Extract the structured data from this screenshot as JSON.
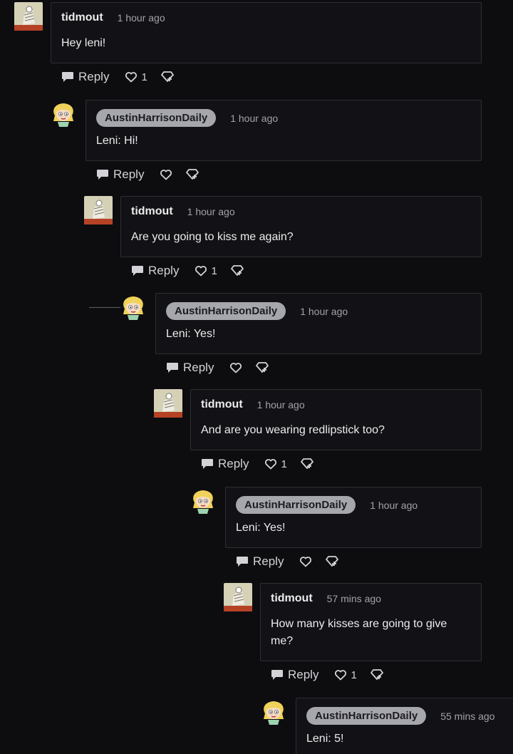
{
  "comments": [
    {
      "user": "tidmout",
      "time": "1 hour ago",
      "text": "Hey leni!",
      "reply_label": "Reply",
      "likes": "1",
      "badge": false
    },
    {
      "user": "AustinHarrisonDaily",
      "time": "1 hour ago",
      "text": "Leni: Hi!",
      "reply_label": "Reply",
      "likes": "",
      "badge": true
    },
    {
      "user": "tidmout",
      "time": "1 hour ago",
      "text": "Are you going to kiss me again?",
      "reply_label": "Reply",
      "likes": "1",
      "badge": false
    },
    {
      "user": "AustinHarrisonDaily",
      "time": "1 hour ago",
      "text": "Leni: Yes!",
      "reply_label": "Reply",
      "likes": "",
      "badge": true
    },
    {
      "user": "tidmout",
      "time": "1 hour ago",
      "text": "And are you wearing redlipstick too?",
      "reply_label": "Reply",
      "likes": "1",
      "badge": false
    },
    {
      "user": "AustinHarrisonDaily",
      "time": "1 hour ago",
      "text": "Leni: Yes!",
      "reply_label": "Reply",
      "likes": "",
      "badge": true
    },
    {
      "user": "tidmout",
      "time": "57 mins ago",
      "text": "How many kisses are going to give me?",
      "reply_label": "Reply",
      "likes": "1",
      "badge": false
    },
    {
      "user": "AustinHarrisonDaily",
      "time": "55 mins ago",
      "text": "Leni: 5!",
      "reply_label": "",
      "likes": "",
      "badge": true
    }
  ],
  "icons": {
    "reply": "speech-bubble-icon",
    "like": "heart-icon",
    "share": "share-icon",
    "avatar_tidmout": "avatar-image",
    "avatar_austin": "leni-avatar-image"
  },
  "colors": {
    "background": "#0d0d10",
    "bubble_border": "#2d2d33",
    "badge_bg": "#a6a6ad",
    "text": "#ececec",
    "muted": "#a1a1a8"
  }
}
